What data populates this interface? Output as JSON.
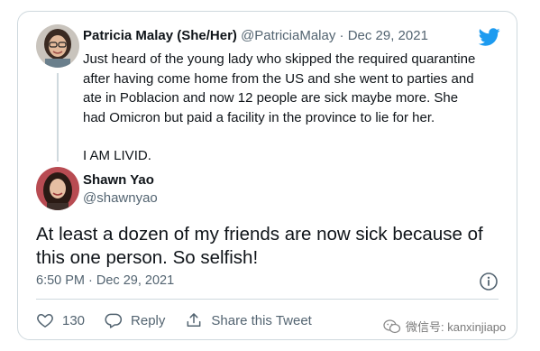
{
  "parent_tweet": {
    "author_name": "Patricia Malay (She/Her)",
    "handle": "@PatriciaMalay",
    "separator": "·",
    "date": "Dec 29, 2021",
    "text_paragraph_1": "Just heard of the young lady who skipped the required quarantine after having come home from the US and she went to parties and ate in Poblacion and now 12 people are sick maybe more. She had Omicron but paid a facility in the province to lie for her.",
    "text_paragraph_2": "I AM LIVID."
  },
  "main_tweet": {
    "author_name": "Shawn Yao",
    "handle": "@shawnyao",
    "text": "At least a dozen of my friends are now sick because of this one person. So selfish!",
    "timestamp": "6:50 PM · Dec 29, 2021"
  },
  "actions": {
    "like_count": "130",
    "reply_label": "Reply",
    "share_label": "Share this Tweet"
  },
  "watermark": {
    "text": "微信号: kanxinjiapo"
  },
  "colors": {
    "twitter_blue": "#1d9bf0",
    "muted": "#536471",
    "border": "#cfd9de"
  },
  "icons": [
    "twitter-logo-icon",
    "info-icon",
    "heart-icon",
    "reply-icon",
    "share-icon",
    "wechat-icon"
  ]
}
